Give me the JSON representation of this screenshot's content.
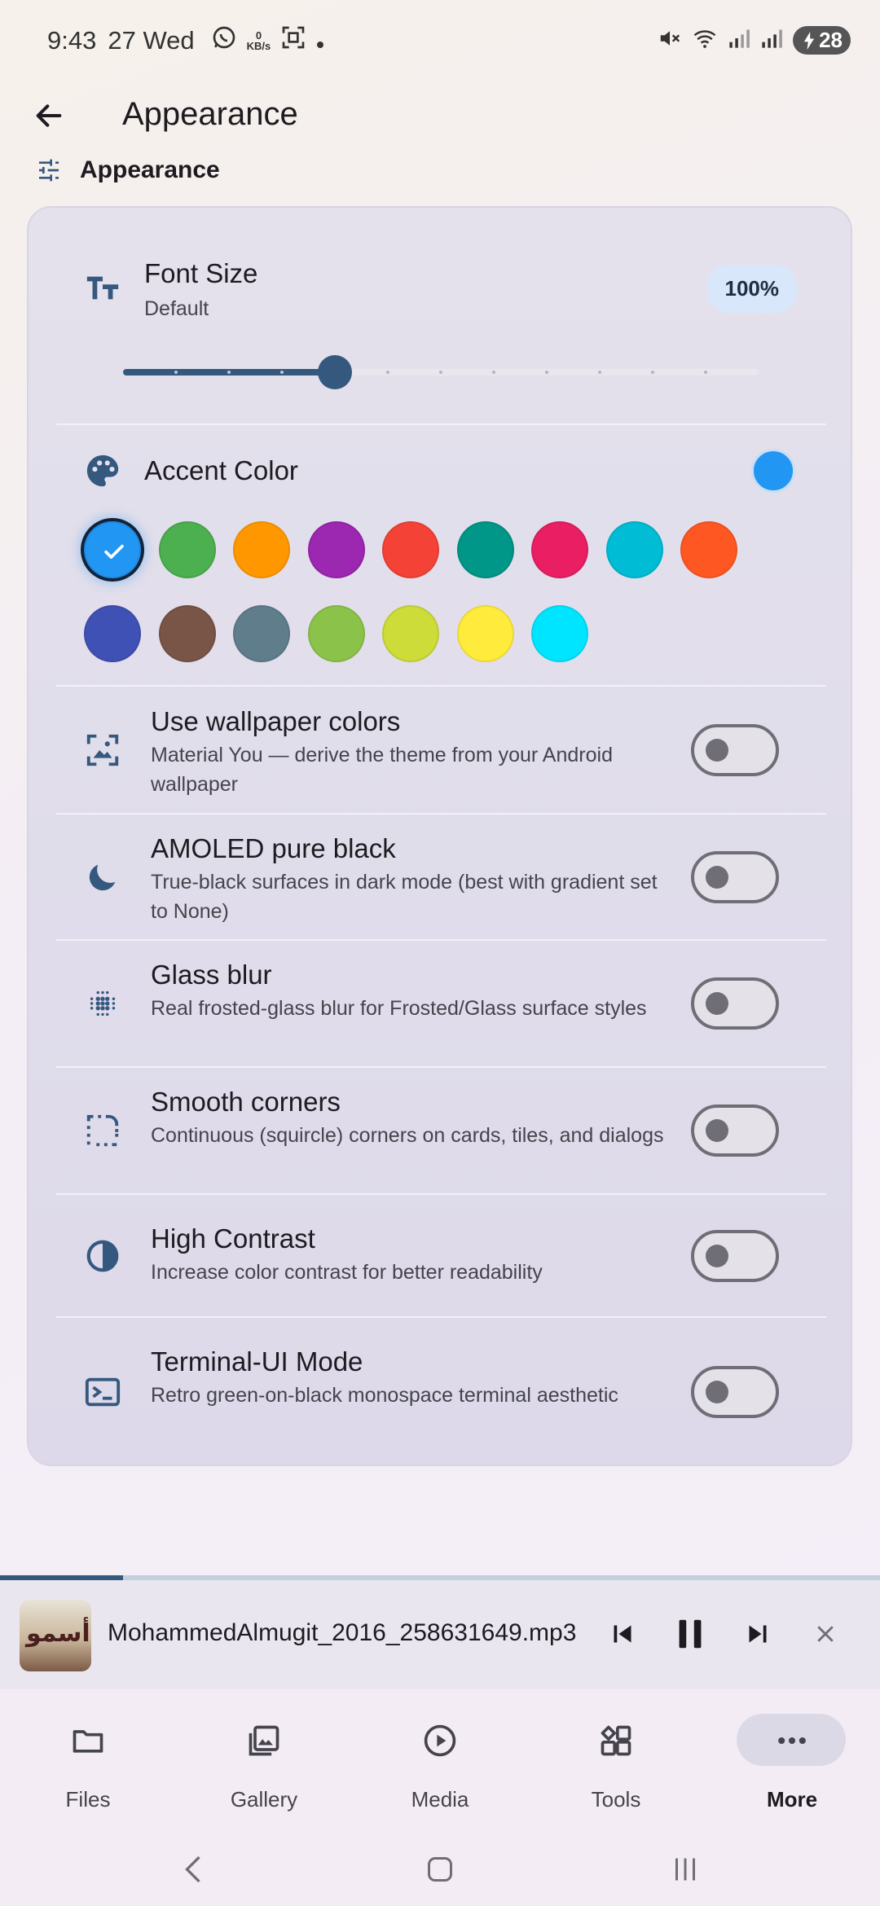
{
  "status_bar": {
    "time": "9:43",
    "date": "27 Wed",
    "net_speed_value": "0",
    "net_speed_unit": "KB/s",
    "battery": "28"
  },
  "app_bar": {
    "title": "Appearance"
  },
  "section": {
    "label": "Appearance"
  },
  "font_size": {
    "title": "Font Size",
    "subtitle": "Default",
    "value_label": "100%",
    "slider_fraction": 0.333,
    "steps": 13
  },
  "accent": {
    "title": "Accent Color",
    "selected": "#2196f3",
    "swatches_row1": [
      "#2196f3",
      "#4caf50",
      "#ff9800",
      "#9c27b0",
      "#f44336",
      "#009688",
      "#e91e63",
      "#00bcd4",
      "#ff5722"
    ],
    "swatches_row2": [
      "#3f51b5",
      "#795548",
      "#607d8b",
      "#8bc34a",
      "#cddc39",
      "#ffeb3b",
      "#00e5ff"
    ]
  },
  "settings": [
    {
      "icon": "wallpaper-icon",
      "title": "Use wallpaper colors",
      "subtitle": "Material You — derive the theme from your Android wallpaper",
      "enabled": false
    },
    {
      "icon": "moon-icon",
      "title": "AMOLED pure black",
      "subtitle": "True-black surfaces in dark mode (best with gradient set to None)",
      "enabled": false
    },
    {
      "icon": "blur-icon",
      "title": "Glass blur",
      "subtitle": "Real frosted-glass blur for Frosted/Glass surface styles",
      "enabled": false
    },
    {
      "icon": "rounded-corner-icon",
      "title": "Smooth corners",
      "subtitle": "Continuous (squircle) corners on cards, tiles, and dialogs",
      "enabled": false
    },
    {
      "icon": "contrast-icon",
      "title": "High Contrast",
      "subtitle": "Increase color contrast for better readability",
      "enabled": false
    },
    {
      "icon": "terminal-icon",
      "title": "Terminal-UI Mode",
      "subtitle": "Retro green-on-black monospace terminal aesthetic",
      "enabled": false
    }
  ],
  "player": {
    "track": "MohammedAlmugit_2016_258631649.mp3",
    "album_art_text": "أسمو",
    "progress": 0.14
  },
  "bottom_nav": [
    {
      "label": "Files",
      "icon": "folder-icon",
      "active": false
    },
    {
      "label": "Gallery",
      "icon": "gallery-icon",
      "active": false
    },
    {
      "label": "Media",
      "icon": "play-circle-icon",
      "active": false
    },
    {
      "label": "Tools",
      "icon": "tools-icon",
      "active": false
    },
    {
      "label": "More",
      "icon": "more-icon",
      "active": true
    }
  ],
  "colors": {
    "primary": "#35587f",
    "accent": "#2196f3"
  }
}
